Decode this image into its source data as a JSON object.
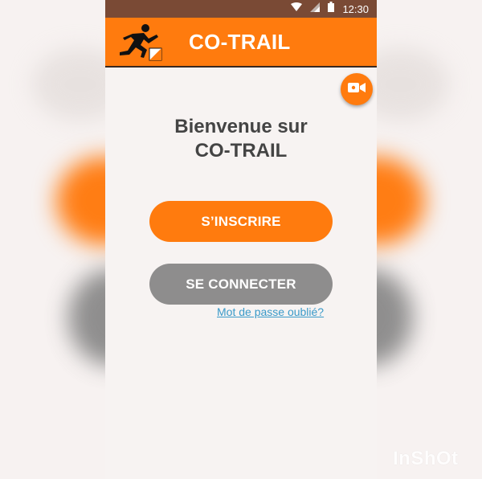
{
  "status_bar": {
    "time": "12:30",
    "icons": [
      "wifi-icon",
      "signal-icon",
      "battery-icon"
    ],
    "color": "#7a4a35"
  },
  "app_bar": {
    "title": "CO-TRAIL",
    "logo": "runner-logo",
    "color": "#ff7b0e"
  },
  "video_button": {
    "icon": "video-camera-icon"
  },
  "welcome": {
    "line1": "Bienvenue sur",
    "line2": "CO-TRAIL"
  },
  "buttons": {
    "signup_label": "S’INSCRIRE",
    "login_label": "SE CONNECTER"
  },
  "forgot_password": "Mot de passe oublié?",
  "watermark": "InShOt",
  "colors": {
    "accent": "#ff7b0e",
    "secondary_button": "#8e8d8d",
    "link": "#3a9ac9",
    "text": "#444444"
  }
}
